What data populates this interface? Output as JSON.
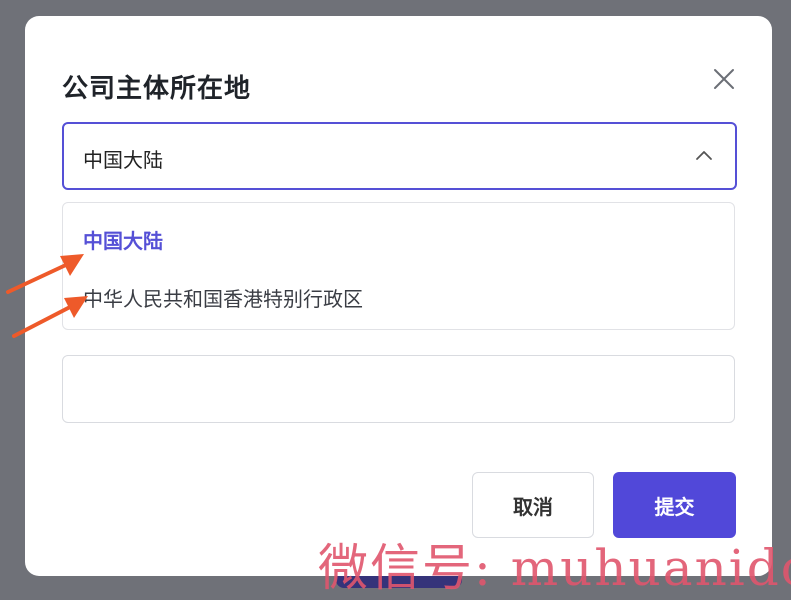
{
  "dialog": {
    "title": "公司主体所在地",
    "select": {
      "value": "中国大陆"
    },
    "options": [
      {
        "label": "中国大陆",
        "selected": true
      },
      {
        "label": "中华人民共和国香港特别行政区",
        "selected": false
      }
    ],
    "text_field": {
      "value": ""
    },
    "buttons": {
      "cancel": "取消",
      "submit": "提交"
    }
  },
  "watermark": "微信号: muhuanidc",
  "colors": {
    "accent": "#5550d6",
    "submit_bg": "#5148d9",
    "overlay": "#6f7178",
    "arrow": "#ee5a2a",
    "watermark": "#e0566d"
  },
  "icons": [
    "close-icon",
    "chevron-up-icon",
    "annotation-arrow"
  ]
}
